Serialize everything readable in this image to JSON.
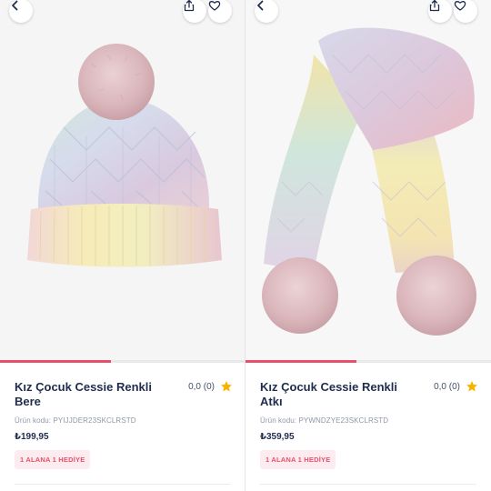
{
  "products": [
    {
      "title": "Kız Çocuk Cessie Renkli Bere",
      "rating_text": "0,0 (0)",
      "code_text": "Ürün kodu: PYIJJDER23SKCLRSTD",
      "price": "₺199,95",
      "badge": "1 ALANA 1 HEDİYE",
      "image_progress": 0.45,
      "icons": {
        "back": "back-arrow-icon",
        "share": "share-icon",
        "favorite": "heart-icon",
        "star": "star-icon"
      }
    },
    {
      "title": "Kız Çocuk Cessie Renkli Atkı",
      "rating_text": "0,0 (0)",
      "code_text": "Ürün kodu: PYWNDZYE23SKCLRSTD",
      "price": "₺359,95",
      "badge": "1 ALANA 1 HEDİYE",
      "image_progress": 0.45,
      "icons": {
        "back": "back-arrow-icon",
        "share": "share-icon",
        "favorite": "heart-icon",
        "star": "star-icon"
      }
    }
  ],
  "colors": {
    "accent": "#e8506a",
    "title": "#1f2d4d",
    "star": "#f4b400",
    "badge_bg": "#fdecef"
  }
}
